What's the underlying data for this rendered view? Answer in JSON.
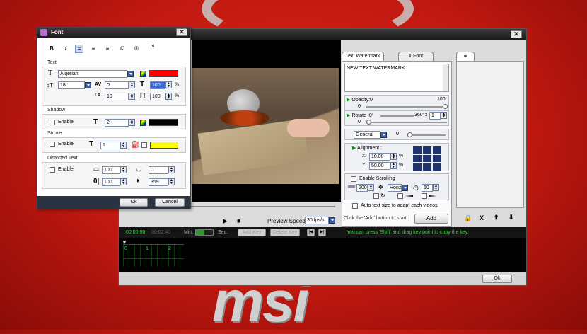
{
  "font_dialog": {
    "title": "Font",
    "toolbar": {
      "bold": "B",
      "italic": "I",
      "copyright": "©",
      "registered": "®",
      "trademark": "™"
    },
    "text_section": {
      "title": "Text",
      "font_family": "Algerian",
      "font_size": "18",
      "char_spacing": "0",
      "line_spacing": "10",
      "scale_h": "100",
      "scale_v": "100",
      "pct": "%",
      "color": "#ff0000"
    },
    "shadow": {
      "title": "Shadow",
      "enable_label": "Enable",
      "size": "2",
      "color": "#000000"
    },
    "stroke": {
      "title": "Stroke",
      "enable_label": "Enable",
      "width": "1",
      "color": "#ffff00"
    },
    "distorted": {
      "title": "Distorted Text",
      "enable_label": "Enable",
      "val1": "100",
      "val2": "0",
      "val3": "100",
      "val4": "359"
    },
    "ok_label": "Ok",
    "cancel_label": "Cancel"
  },
  "playback": {
    "preview_speed_label": "Preview Speed:",
    "preview_speed_value": "30 fps/s"
  },
  "watermark_panel": {
    "tab_text": "Text Watermark",
    "tab_font": "Font",
    "tab_font_icon": "T",
    "text_value": "NEW TEXT WATERMARK",
    "opacity_label": "Opacity",
    "opacity_min": ":0",
    "opacity_max": "100",
    "opacity_value": "0",
    "rotate_label": "Rotate",
    "rotate_min": ":0°",
    "rotate_max": "360°",
    "rotate_x": "x",
    "rotate_step": "1",
    "rotate_value": "0",
    "general_label": "General",
    "general_value": "0",
    "alignment_label": "Alignment :",
    "x_label": "X:",
    "x_value": "10.00",
    "y_label": "Y:",
    "y_value": "50.00",
    "pct": "%",
    "enable_scrolling_label": "Enable Scrolling",
    "scroll_speed": "200",
    "scroll_dir": "Horiz",
    "scroll_time": "50",
    "auto_text_label": "Auto text size to adapt each videos.",
    "hint": "Click the 'Add' button to start :",
    "add_label": "Add"
  },
  "list_panel": {
    "delete_label": "X"
  },
  "timeline": {
    "time_current": "00:00:00",
    "time_total": "00:02:40",
    "min_label": "Min.",
    "sec_label": "Sec.",
    "add_key_label": "Add Key",
    "delete_key_label": "Delete Key",
    "hint": "You can press 'Shift' and drag key point to copy the key.",
    "ruler": [
      "0",
      "1",
      "2"
    ]
  },
  "main_ok_label": "Ok",
  "desktop_logo_text": "msi"
}
